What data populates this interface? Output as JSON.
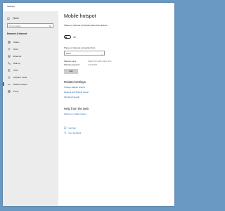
{
  "window": {
    "title": "Settings"
  },
  "sidebar": {
    "home_label": "Home",
    "search_placeholder": "Find a setting",
    "section_title": "Network & Internet",
    "items": [
      {
        "label": "Status",
        "icon": "globe-icon"
      },
      {
        "label": "Wi-Fi",
        "icon": "wifi-icon"
      },
      {
        "label": "Ethernet",
        "icon": "ethernet-icon"
      },
      {
        "label": "Dial-up",
        "icon": "phone-icon"
      },
      {
        "label": "VPN",
        "icon": "vpn-icon"
      },
      {
        "label": "Airplane mode",
        "icon": "airplane-icon"
      },
      {
        "label": "Mobile hotspot",
        "icon": "hotspot-icon"
      },
      {
        "label": "Proxy",
        "icon": "globe-icon"
      }
    ]
  },
  "main": {
    "title": "Mobile hotspot",
    "share_label": "Share my Internet connection with other devices",
    "toggle_state": "Off",
    "share_from_label": "Share my Internet connection from",
    "share_from_value": "Wi-Fi",
    "network_name_label": "Network name",
    "network_name_value": "DESKTOP-GRTLHMA 1245",
    "network_password_label": "Network password",
    "network_password_value": "7y1b32#4b",
    "edit_button": "Edit",
    "related_title": "Related settings",
    "related_links": [
      "Change adapter options",
      "Network and Sharing Center",
      "Windows Firewall"
    ],
    "help_title": "Help from the web",
    "help_link": "Setting up mobile hotspot",
    "get_help": "Get help",
    "give_feedback": "Give feedback"
  },
  "colors": {
    "accent": "#1a73c8",
    "link": "#1763b0",
    "sidebar_bg": "#ececec",
    "desktop_bg": "#6a9ac4"
  }
}
